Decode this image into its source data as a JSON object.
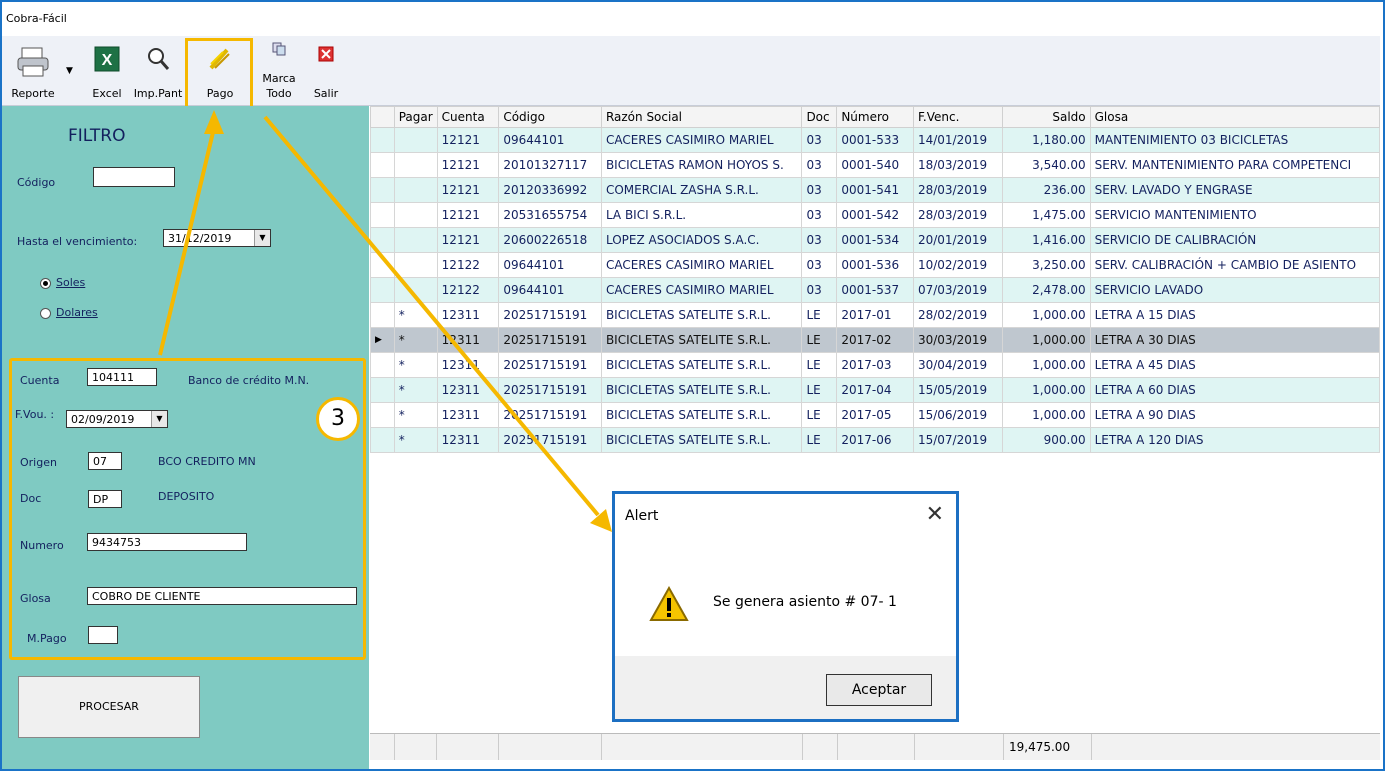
{
  "window": {
    "title": "Cobra-Fácil"
  },
  "toolbar": {
    "reporte": "Reporte",
    "excel": "Excel",
    "imp_pant": "Imp.Pant",
    "pago": "Pago",
    "marca_todo_1": "Marca",
    "marca_todo_2": "Todo",
    "salir": "Salir"
  },
  "filter": {
    "title": "FILTRO",
    "codigo_label": "Código",
    "codigo_value": "",
    "hasta_label": "Hasta el vencimiento:",
    "hasta_value": "31/12/2019",
    "soles": "Soles",
    "dolares": "Dolares"
  },
  "voucher": {
    "cuenta_label": "Cuenta",
    "cuenta_value": "104111",
    "cuenta_desc": "Banco de crédito M.N.",
    "fvou_label": "F.Vou. :",
    "fvou_value": "02/09/2019",
    "origen_label": "Origen",
    "origen_value": "07",
    "origen_desc": "BCO CREDITO MN",
    "doc_label": "Doc",
    "doc_value": "DP",
    "doc_desc": "DEPOSITO",
    "numero_label": "Numero",
    "numero_value": "9434753",
    "glosa_label": "Glosa",
    "glosa_value": "COBRO DE CLIENTE",
    "mpago_label": "M.Pago",
    "mpago_value": ""
  },
  "annotation": {
    "step": "3"
  },
  "procesar": "PROCESAR",
  "grid": {
    "headers": [
      "Pagar",
      "Cuenta",
      "Código",
      "Razón Social",
      "Doc",
      "Número",
      "F.Venc.",
      "Saldo",
      "Glosa"
    ],
    "rows": [
      [
        "",
        "12121",
        "09644101",
        "CACERES CASIMIRO MARIEL",
        "03",
        "0001-533",
        "14/01/2019",
        "1,180.00",
        "MANTENIMIENTO 03 BICICLETAS"
      ],
      [
        "",
        "12121",
        "20101327117",
        "BICICLETAS RAMON HOYOS S.",
        "03",
        "0001-540",
        "18/03/2019",
        "3,540.00",
        "SERV. MANTENIMIENTO PARA COMPETENCI"
      ],
      [
        "",
        "12121",
        "20120336992",
        "COMERCIAL ZASHA S.R.L.",
        "03",
        "0001-541",
        "28/03/2019",
        "236.00",
        "SERV. LAVADO  Y ENGRASE"
      ],
      [
        "",
        "12121",
        "20531655754",
        "LA BICI S.R.L.",
        "03",
        "0001-542",
        "28/03/2019",
        "1,475.00",
        "SERVICIO MANTENIMIENTO"
      ],
      [
        "",
        "12121",
        "20600226518",
        "LOPEZ ASOCIADOS S.A.C.",
        "03",
        "0001-534",
        "20/01/2019",
        "1,416.00",
        "SERVICIO DE CALIBRACIÓN"
      ],
      [
        "",
        "12122",
        "09644101",
        "CACERES CASIMIRO MARIEL",
        "03",
        "0001-536",
        "10/02/2019",
        "3,250.00",
        "SERV. CALIBRACIÓN + CAMBIO DE ASIENTO"
      ],
      [
        "",
        "12122",
        "09644101",
        "CACERES CASIMIRO MARIEL",
        "03",
        "0001-537",
        "07/03/2019",
        "2,478.00",
        "SERVICIO LAVADO"
      ],
      [
        "*",
        "12311",
        "20251715191",
        "BICICLETAS SATELITE S.R.L.",
        "LE",
        "2017-01",
        "28/02/2019",
        "1,000.00",
        "LETRA A 15 DIAS"
      ],
      [
        "*",
        "12311",
        "20251715191",
        "BICICLETAS SATELITE S.R.L.",
        "LE",
        "2017-02",
        "30/03/2019",
        "1,000.00",
        "LETRA A 30 DIAS"
      ],
      [
        "*",
        "12311",
        "20251715191",
        "BICICLETAS SATELITE S.R.L.",
        "LE",
        "2017-03",
        "30/04/2019",
        "1,000.00",
        "LETRA A 45 DIAS"
      ],
      [
        "*",
        "12311",
        "20251715191",
        "BICICLETAS SATELITE S.R.L.",
        "LE",
        "2017-04",
        "15/05/2019",
        "1,000.00",
        "LETRA A 60 DIAS"
      ],
      [
        "*",
        "12311",
        "20251715191",
        "BICICLETAS SATELITE S.R.L.",
        "LE",
        "2017-05",
        "15/06/2019",
        "1,000.00",
        "LETRA A 90 DIAS"
      ],
      [
        "*",
        "12311",
        "20251715191",
        "BICICLETAS SATELITE S.R.L.",
        "LE",
        "2017-06",
        "15/07/2019",
        "900.00",
        "LETRA A 120 DIAS"
      ]
    ],
    "current_row": 8,
    "total": "19,475.00"
  },
  "dialog": {
    "title": "Alert",
    "message": "Se genera asiento # 07-   1",
    "ok": "Aceptar"
  }
}
